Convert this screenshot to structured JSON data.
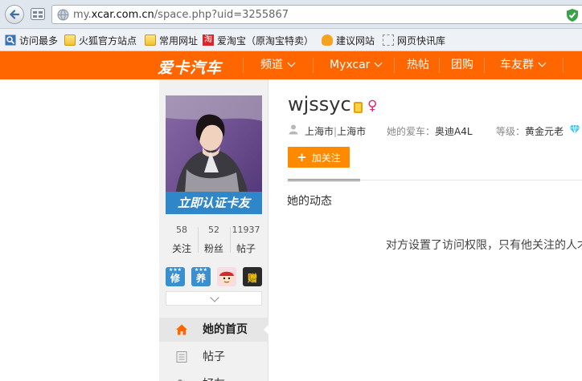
{
  "browser": {
    "url_prefix": "my.",
    "url_domain": "xcar.com.cn",
    "url_path": "/space.php?uid=3255867",
    "bookmarks": [
      {
        "label": "访问最多",
        "icon": "magnifier-icon"
      },
      {
        "label": "火狐官方站点",
        "icon": "folder-icon"
      },
      {
        "label": "常用网址",
        "icon": "folder-icon"
      },
      {
        "label": "爱淘宝（原淘宝特卖）",
        "icon": "taobao-icon"
      },
      {
        "label": "建议网站",
        "icon": "lightbulb-icon"
      },
      {
        "label": "网页快讯库",
        "icon": "webslice-icon"
      }
    ],
    "taobao_glyph": "淘"
  },
  "site": {
    "logo": "爱卡汽车",
    "nav": [
      {
        "label": "频道",
        "has_dropdown": true
      },
      {
        "label": "Myxcar",
        "has_dropdown": true
      },
      {
        "label": "热帖",
        "has_dropdown": false
      },
      {
        "label": "团购",
        "has_dropdown": false
      },
      {
        "label": "车友群",
        "has_dropdown": true
      }
    ],
    "accent_color": "#ff6600"
  },
  "profile": {
    "cert_banner": "立即认证卡友",
    "stats": [
      {
        "value": "58",
        "label": "关注"
      },
      {
        "value": "52",
        "label": "粉丝"
      },
      {
        "value": "11937",
        "label": "帖子"
      }
    ],
    "badges": [
      {
        "glyph": "修",
        "color": "#3a8fd0"
      },
      {
        "glyph": "养",
        "color": "#3a8fd0"
      },
      {
        "glyph": "",
        "color": "#f3c6cf"
      },
      {
        "glyph": "赠",
        "color": "#2a2a2a"
      }
    ],
    "menu": [
      {
        "label": "她的首页",
        "icon": "home-icon",
        "active": true
      },
      {
        "label": "帖子",
        "icon": "list-icon",
        "active": false
      },
      {
        "label": "好友",
        "icon": "friends-icon",
        "active": false
      }
    ]
  },
  "main": {
    "username": "wjssyc",
    "location_city": "上海市",
    "location_district": "上海市",
    "location_sep": "|",
    "car_label": "她的爱车：",
    "car_value": "奥迪A4L",
    "level_label": "等级：",
    "level_value": "黄金元老",
    "follow_label": "加关注",
    "tab_label": "她的动态",
    "notice": "对方设置了访问权限，只有他关注的人才能访问"
  }
}
